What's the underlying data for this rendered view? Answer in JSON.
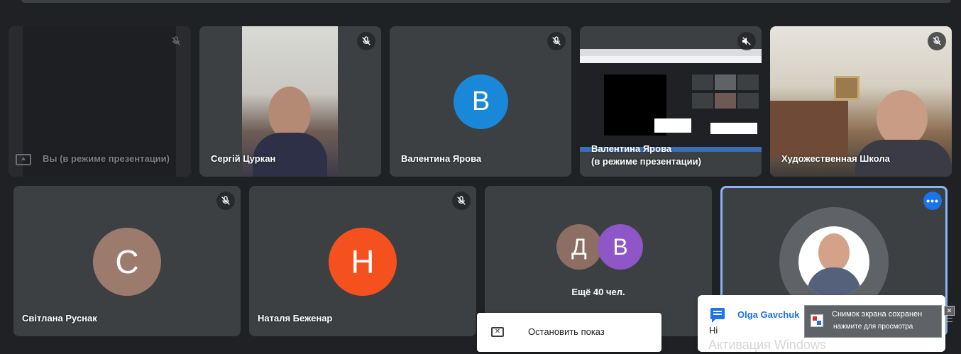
{
  "participants_top": [
    {
      "name": "Вы (в режиме презентации)"
    },
    {
      "name": "Сергій Цуркан"
    },
    {
      "name": "Валентина Ярова",
      "initial": "В",
      "color": "#1a88d8"
    },
    {
      "name_line1": "Валентина Ярова",
      "name_line2": "(в режиме презентации)"
    },
    {
      "name": "Художественная Школа"
    }
  ],
  "participants_bottom": [
    {
      "name": "Світлана Руснак",
      "initial": "С",
      "color": "#9c7b6c"
    },
    {
      "name": "Наталя Беженар",
      "initial": "Н",
      "color": "#f4511e"
    },
    {
      "more_label": "Ещё 40 чел.",
      "initials": [
        "Д",
        "В"
      ],
      "colors": [
        "#8d6e63",
        "#8e56c6"
      ]
    }
  ],
  "stop_presenting": {
    "label": "Остановить показ"
  },
  "chat_toast": {
    "sender": "Olga Gavchuk",
    "message": "Hi"
  },
  "screenshot_note": {
    "title": "Снимок экрана сохранен",
    "subtitle": "нажмите для просмотра"
  },
  "watermark": "Активация Windows",
  "colors": {
    "accent": "#1a73e8",
    "tile_bg": "#3c4043",
    "page_bg": "#202124"
  }
}
